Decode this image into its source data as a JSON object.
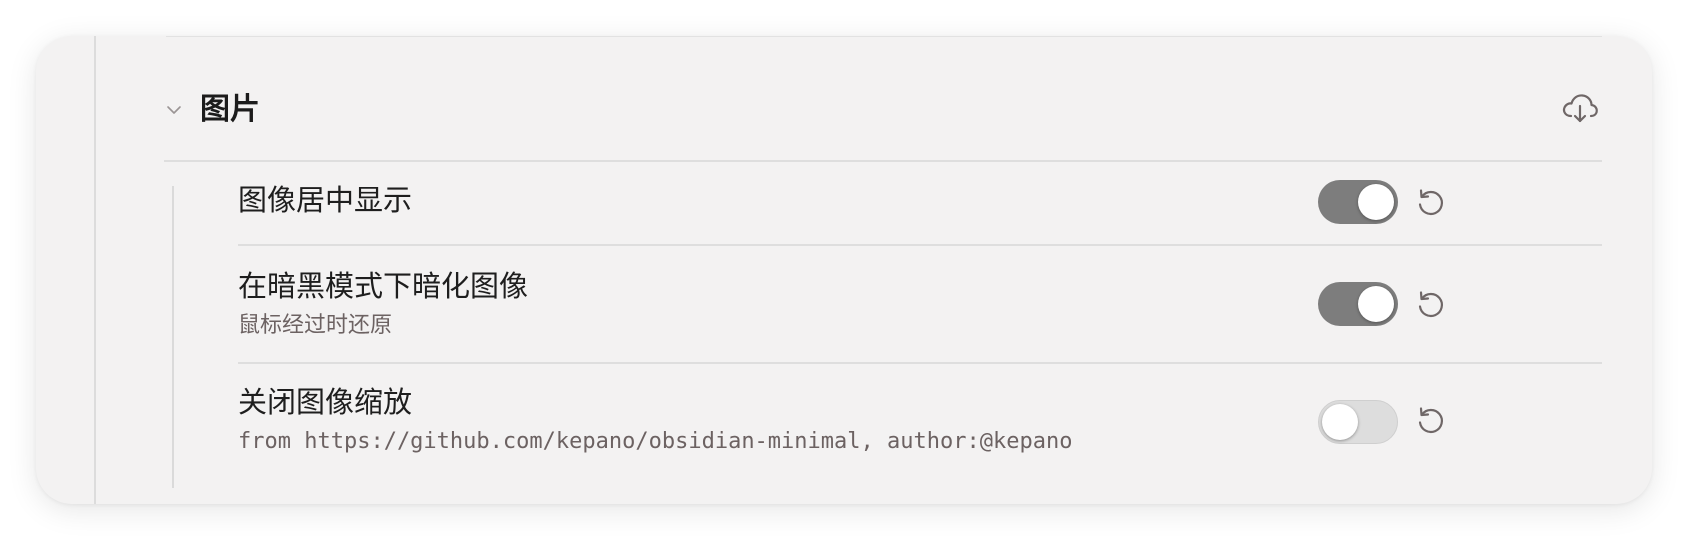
{
  "section": {
    "title": "图片",
    "expanded": true
  },
  "settings": [
    {
      "title": "图像居中显示",
      "description": "",
      "enabled": true
    },
    {
      "title": "在暗黑模式下暗化图像",
      "description": "鼠标经过时还原",
      "enabled": true
    },
    {
      "title": "关闭图像缩放",
      "description": "from https://github.com/kepano/obsidian-minimal, author:@kepano",
      "enabled": false
    }
  ],
  "icons": {
    "collapse": "chevron-down-icon",
    "download": "cloud-download-icon",
    "reset": "reset-icon"
  },
  "colors": {
    "card_background": "#f3f2f2",
    "toggle_on": "#7d7d7d",
    "toggle_off": "#dddddd",
    "icon": "#6f6767",
    "description": "#6c6262"
  }
}
